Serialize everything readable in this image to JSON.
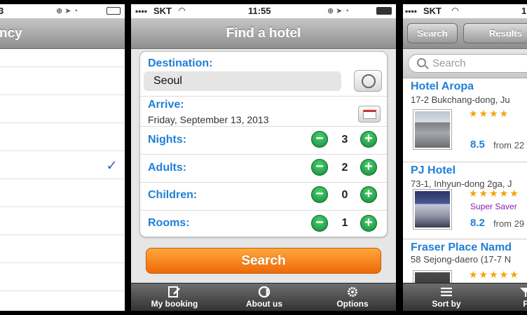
{
  "left_panel": {
    "status": {
      "time": "3"
    },
    "nav_title": "ncy",
    "list_rows": 9,
    "checked_row_index": 4
  },
  "center_panel": {
    "status": {
      "carrier": "SKT",
      "time": "11:55"
    },
    "title": "Find a hotel",
    "form": {
      "destination_label": "Destination:",
      "destination_value": "Seoul",
      "arrive_label": "Arrive:",
      "arrive_value": "Friday, September 13, 2013",
      "nights": {
        "label": "Nights:",
        "value": "3"
      },
      "adults": {
        "label": "Adults:",
        "value": "2"
      },
      "children": {
        "label": "Children:",
        "value": "0"
      },
      "rooms": {
        "label": "Rooms:",
        "value": "1"
      }
    },
    "search_button": "Search",
    "tabs": [
      {
        "label": "My booking",
        "icon": "edit-document-icon"
      },
      {
        "label": "About us",
        "icon": "at-sign-icon"
      },
      {
        "label": "Options",
        "icon": "gear-icon"
      }
    ]
  },
  "right_panel": {
    "status": {
      "carrier": "SKT",
      "time": "1"
    },
    "back_button": "Search",
    "results_button": "Results",
    "search_placeholder": "Search",
    "hotels": [
      {
        "name": "Hotel Aropa",
        "address": "17-2 Bukchang-dong, Ju",
        "stars": "★★★★",
        "rating": "8.5",
        "from": "from 22",
        "stars_count": 4
      },
      {
        "name": "PJ Hotel",
        "address": "73-1, Inhyun-dong 2ga, J",
        "stars": "★★★★★",
        "promo": "Super Saver",
        "rating": "8.2",
        "from": "from 29",
        "stars_count": 5
      },
      {
        "name": "Fraser Place Namd",
        "address": "58 Sejong-daero (17-7 N",
        "stars": "★★★★★",
        "stars_count": 5
      }
    ],
    "tabs": [
      {
        "label": "Sort by",
        "icon": "list-icon"
      },
      {
        "label": "F",
        "icon": "filter-icon"
      }
    ]
  },
  "colors": {
    "accent_blue": "#1f7fd6",
    "search_orange": "#f08a1c",
    "stepper_green": "#1ea64a",
    "promo_purple": "#8b1fb0",
    "star_gold": "#f2a40c"
  }
}
